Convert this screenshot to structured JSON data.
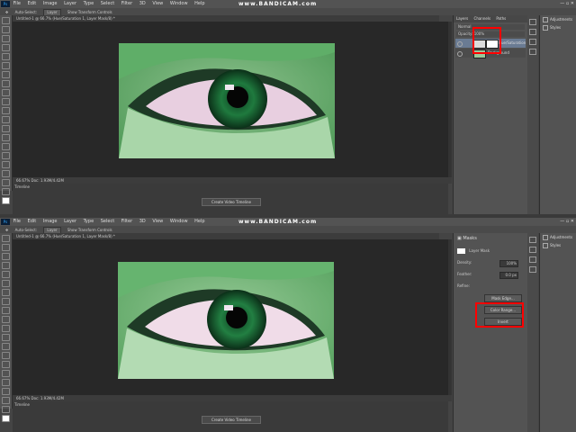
{
  "watermark": "www.BANDICAM.com",
  "menu": {
    "logo": "Ps",
    "items": [
      "File",
      "Edit",
      "Image",
      "Layer",
      "Type",
      "Select",
      "Filter",
      "3D",
      "View",
      "Window",
      "Help"
    ],
    "window_controls": "— ▫ ✕"
  },
  "options": {
    "auto_select": "Auto-Select:",
    "layer_select": "Layer",
    "show_transform": "Show Transform Controls"
  },
  "top": {
    "doc_tab": "Untitled-1 @ 66.7% (Hue/Saturation 1, Layer Mask/8) *",
    "status": "66.67%   Doc: 1.93M/4.42M",
    "timeline_tab": "Timeline",
    "timeline_button": "Create Video Timeline",
    "panel_tabs": [
      "Layers",
      "Channels",
      "Paths"
    ],
    "blend_mode": "Normal",
    "opacity": "Opacity: 100%",
    "layers": [
      {
        "name": "Hue/Saturation 1",
        "selected": true
      },
      {
        "name": "Background",
        "selected": false
      }
    ]
  },
  "bottom": {
    "doc_tab": "Untitled-1 @ 66.7% (Hue/Saturation 1, Layer Mask/8) *",
    "status": "66.67%   Doc: 1.93M/4.42M",
    "timeline_tab": "Timeline",
    "timeline_button": "Create Video Timeline",
    "prop_title": "Masks",
    "prop_sub": "Layer Mask",
    "density_label": "Density:",
    "density_value": "100%",
    "feather_label": "Feather:",
    "feather_value": "0.0 px",
    "refine_label": "Refine:",
    "mask_edge_button": "Mask Edge...",
    "color_range_button": "Color Range...",
    "invert_button": "Invert"
  },
  "right_panel": {
    "items": [
      "Adjustments",
      "Styles"
    ]
  }
}
